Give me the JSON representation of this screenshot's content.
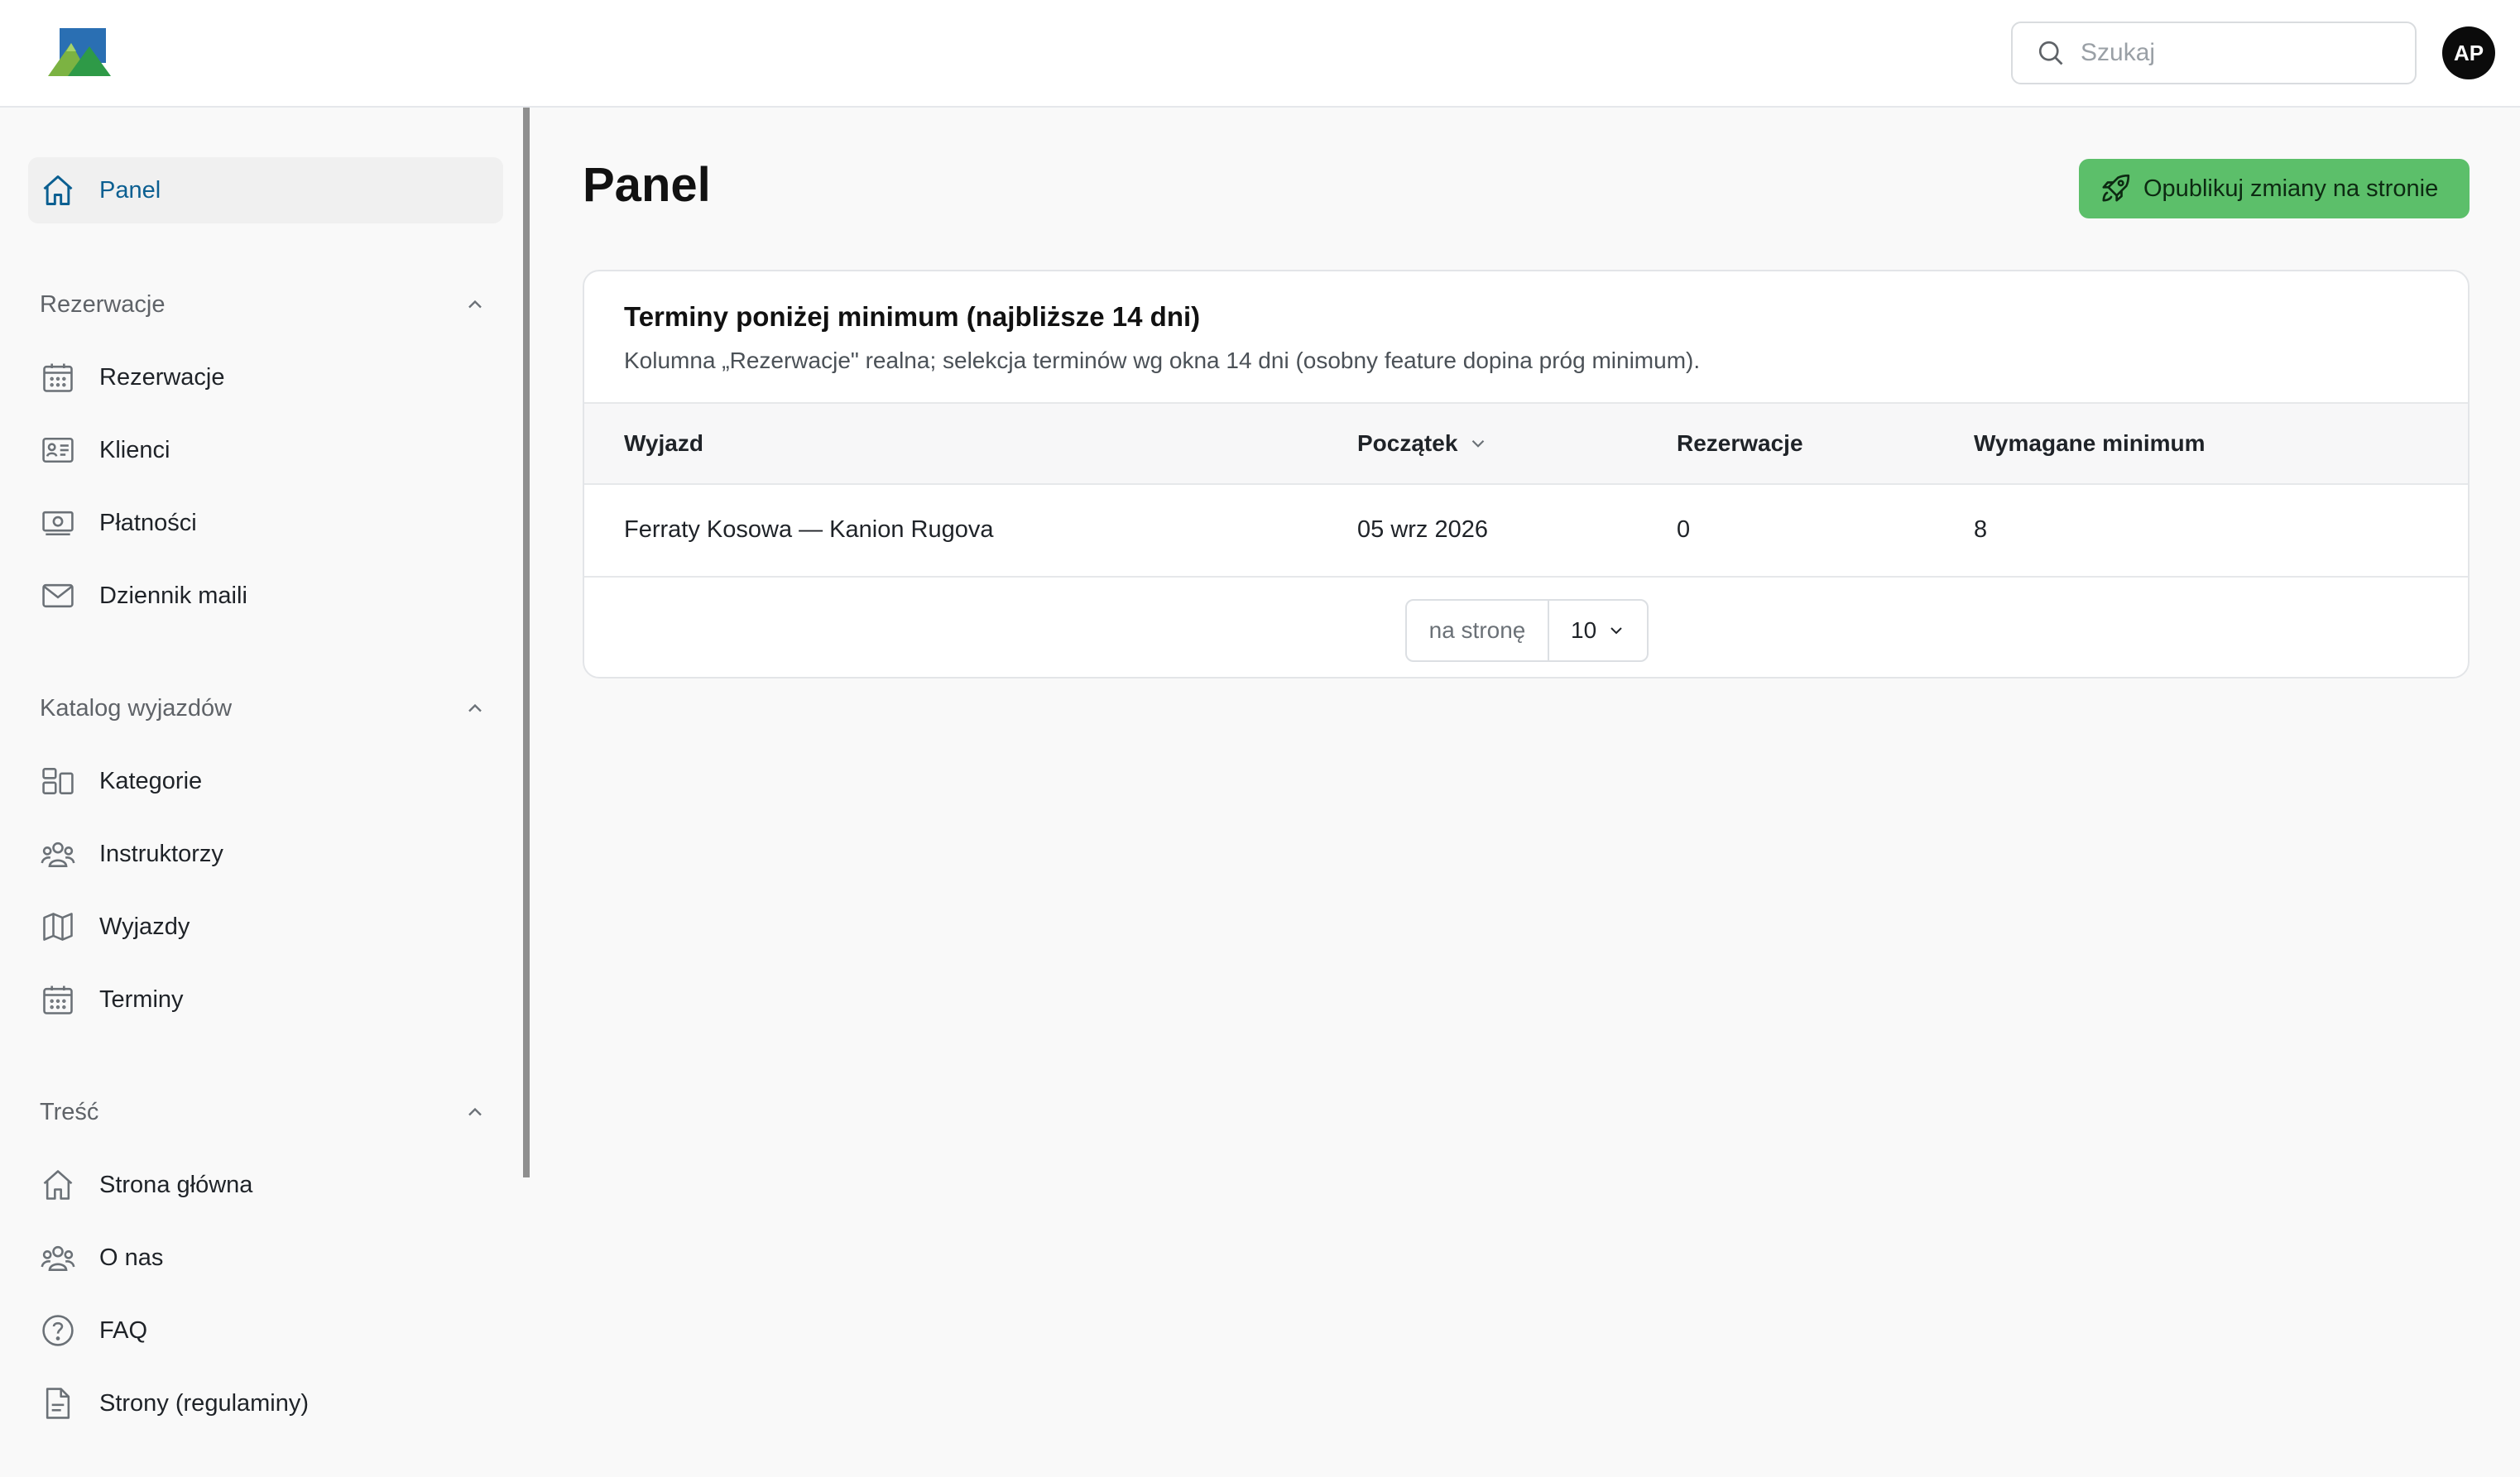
{
  "header": {
    "search_placeholder": "Szukaj",
    "avatar_initials": "AP",
    "logo_icon": "mountains-logo-icon"
  },
  "sidebar": {
    "top_item": {
      "label": "Panel",
      "icon": "home-icon",
      "active": true
    },
    "groups": [
      {
        "label": "Rezerwacje",
        "expanded": true,
        "items": [
          {
            "label": "Rezerwacje",
            "icon": "calendar-icon"
          },
          {
            "label": "Klienci",
            "icon": "id-card-icon"
          },
          {
            "label": "Płatności",
            "icon": "banknote-icon"
          },
          {
            "label": "Dziennik maili",
            "icon": "mail-icon"
          }
        ]
      },
      {
        "label": "Katalog wyjazdów",
        "expanded": true,
        "items": [
          {
            "label": "Kategorie",
            "icon": "categories-icon"
          },
          {
            "label": "Instruktorzy",
            "icon": "users-icon"
          },
          {
            "label": "Wyjazdy",
            "icon": "map-icon"
          },
          {
            "label": "Terminy",
            "icon": "calendar-icon"
          }
        ]
      },
      {
        "label": "Treść",
        "expanded": true,
        "items": [
          {
            "label": "Strona główna",
            "icon": "home-icon"
          },
          {
            "label": "O nas",
            "icon": "users-icon"
          },
          {
            "label": "FAQ",
            "icon": "question-icon"
          },
          {
            "label": "Strony (regulaminy)",
            "icon": "document-icon"
          }
        ]
      }
    ]
  },
  "main": {
    "title": "Panel",
    "publish_label": "Opublikuj zmiany na stronie",
    "card": {
      "title": "Terminy poniżej minimum (najbliższe 14 dni)",
      "description": "Kolumna „Rezerwacje\" realna; selekcja terminów wg okna 14 dni (osobny feature dopina próg minimum).",
      "columns": [
        "Wyjazd",
        "Początek",
        "Rezerwacje",
        "Wymagane minimum"
      ],
      "sorted_column": "Początek",
      "rows": [
        {
          "trip": "Ferraty Kosowa — Kanion Rugova",
          "start": "05 wrz 2026",
          "bookings": "0",
          "minimum": "8"
        }
      ],
      "pagination": {
        "per_page_label": "na stronę",
        "per_page_value": "10"
      }
    }
  },
  "colors": {
    "accent_active": "#0b5f91",
    "publish_button": "#5cbf6a",
    "background": "#f9f9f9"
  }
}
